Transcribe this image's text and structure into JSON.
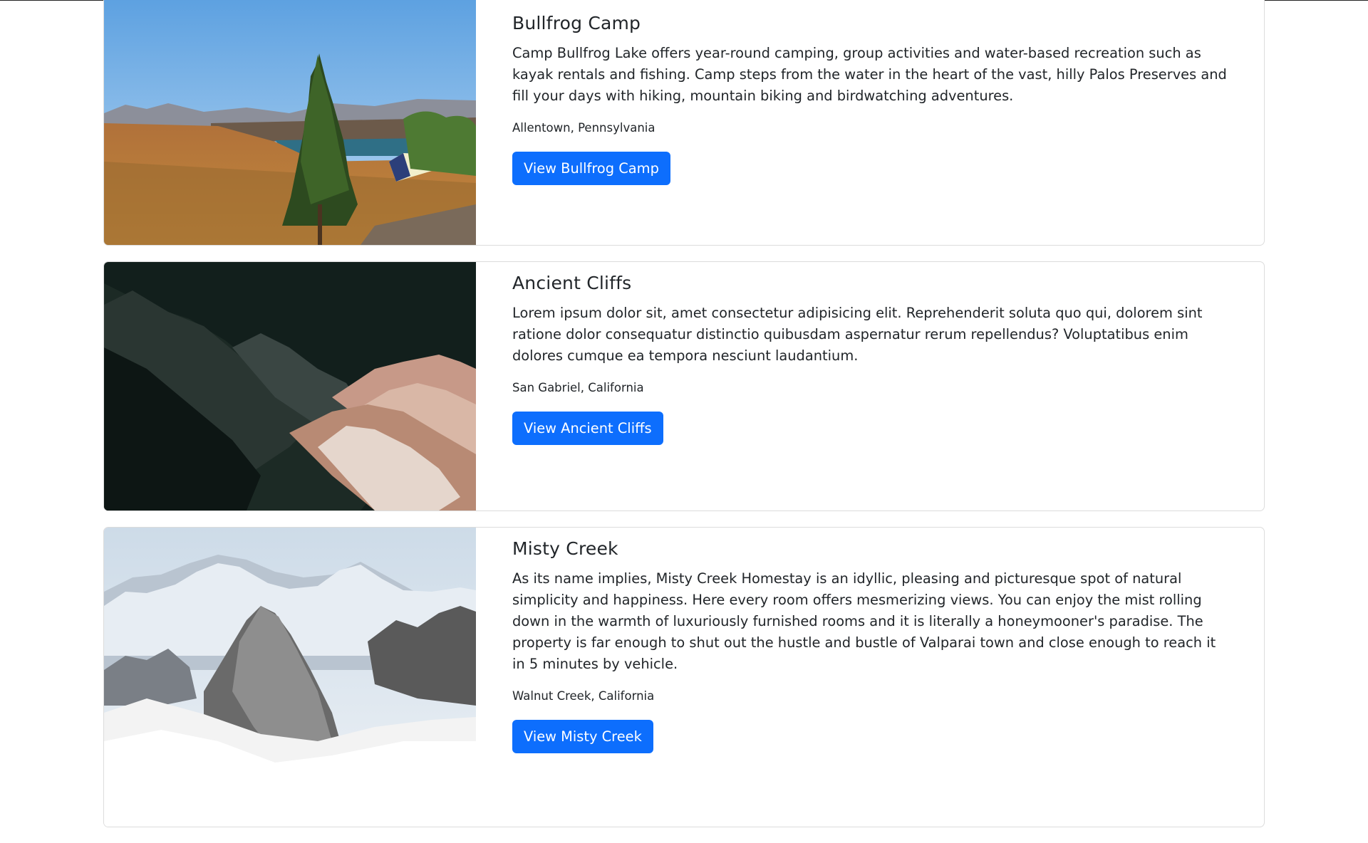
{
  "campgrounds": [
    {
      "title": "Bullfrog Camp",
      "description": "Camp Bullfrog Lake offers year-round camping, group activities and water-based recreation such as kayak rentals and fishing. Camp steps from the water in the heart of the vast, hilly Palos Preserves and fill your days with hiking, mountain biking and birdwatching adventures.",
      "location": "Allentown, Pennsylvania",
      "button": "View Bullfrog Camp"
    },
    {
      "title": "Ancient Cliffs",
      "description": "Lorem ipsum dolor sit, amet consectetur adipisicing elit. Reprehenderit soluta quo qui, dolorem sint ratione dolor consequatur distinctio quibusdam aspernatur rerum repellendus? Voluptatibus enim dolores cumque ea tempora nesciunt laudantium.",
      "location": "San Gabriel, California",
      "button": "View Ancient Cliffs"
    },
    {
      "title": "Misty Creek",
      "description": "As its name implies, Misty Creek Homestay is an idyllic, pleasing and picturesque spot of natural simplicity and happiness. Here every room offers mesmerizing views. You can enjoy the mist rolling down in the warmth of luxuriously furnished rooms and it is literally a honeymooner's paradise. The property is far enough to shut out the hustle and bustle of Valparai town and close enough to reach it in 5 minutes by vehicle.",
      "location": "Walnut Creek, California",
      "button": "View Misty Creek"
    }
  ],
  "colors": {
    "button_bg": "#0d6efd",
    "card_border": "#dcdcdc"
  }
}
